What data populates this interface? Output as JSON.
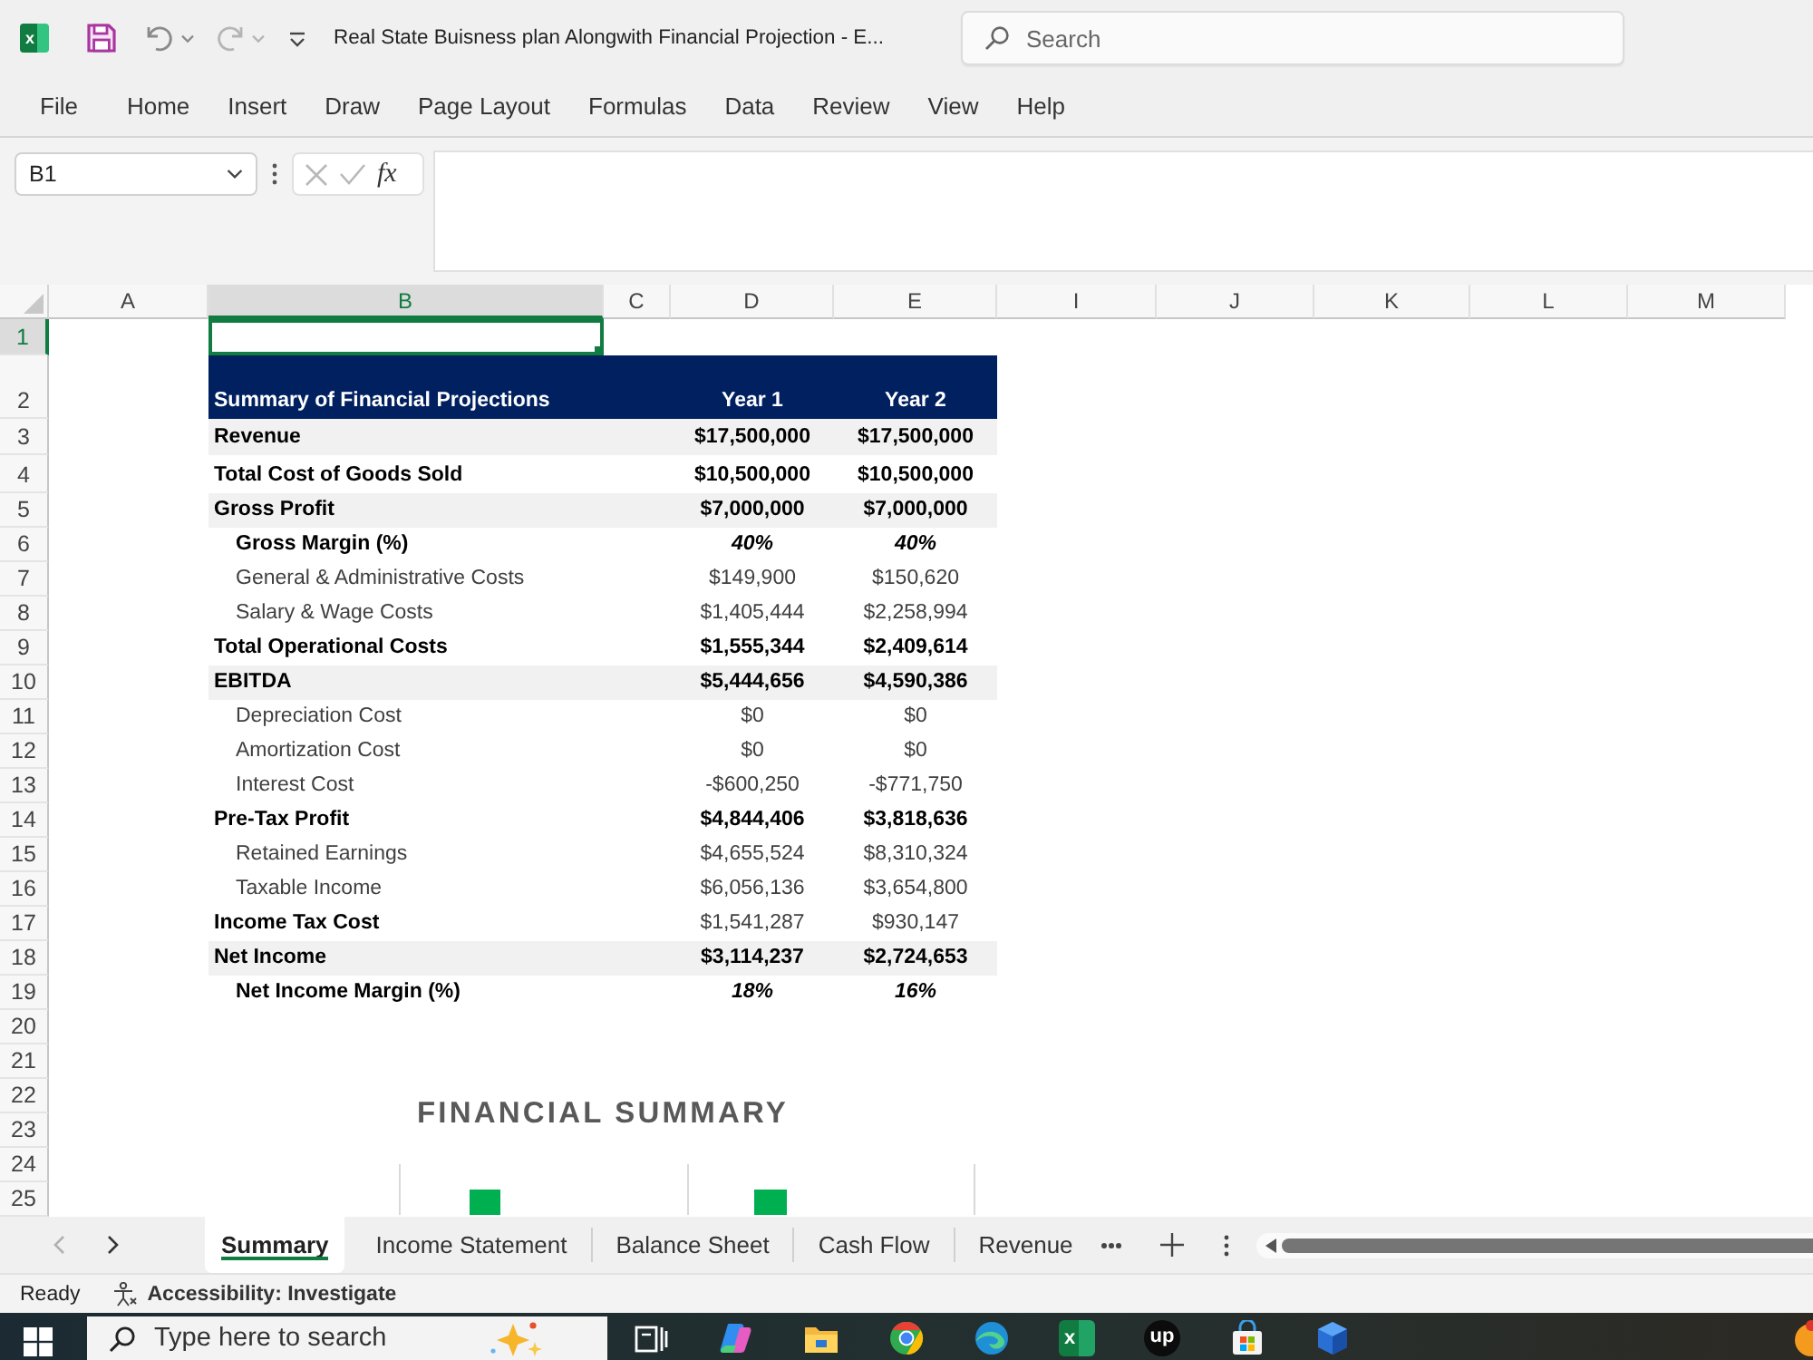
{
  "title_bar": {
    "app_icon_letter": "x",
    "title": "Real State Buisness plan Alongwith Financial Projection - E...",
    "search": {
      "placeholder": "Search"
    }
  },
  "menu": [
    "File",
    "Home",
    "Insert",
    "Draw",
    "Page Layout",
    "Formulas",
    "Data",
    "Review",
    "View",
    "Help"
  ],
  "formula_bar": {
    "name_box": "B1",
    "function_label": "fx"
  },
  "sheet": {
    "columns": [
      {
        "label": "A",
        "selected": false
      },
      {
        "label": "B",
        "selected": true
      },
      {
        "label": "C",
        "selected": false
      },
      {
        "label": "D",
        "selected": false
      },
      {
        "label": "E",
        "selected": false
      },
      {
        "label": "I",
        "selected": false
      },
      {
        "label": "J",
        "selected": false
      },
      {
        "label": "K",
        "selected": false
      },
      {
        "label": "L",
        "selected": false
      },
      {
        "label": "M",
        "selected": false
      }
    ],
    "rows": [
      {
        "label": "1",
        "selected": true
      },
      {
        "label": "2",
        "selected": false
      },
      {
        "label": "3",
        "selected": false
      },
      {
        "label": "4",
        "selected": false
      },
      {
        "label": "5",
        "selected": false
      },
      {
        "label": "6",
        "selected": false
      },
      {
        "label": "7",
        "selected": false
      },
      {
        "label": "8",
        "selected": false
      },
      {
        "label": "9",
        "selected": false
      },
      {
        "label": "10",
        "selected": false
      },
      {
        "label": "11",
        "selected": false
      },
      {
        "label": "12",
        "selected": false
      },
      {
        "label": "13",
        "selected": false
      },
      {
        "label": "14",
        "selected": false
      },
      {
        "label": "15",
        "selected": false
      },
      {
        "label": "16",
        "selected": false
      },
      {
        "label": "17",
        "selected": false
      },
      {
        "label": "18",
        "selected": false
      },
      {
        "label": "19",
        "selected": false
      },
      {
        "label": "20",
        "selected": false
      },
      {
        "label": "21",
        "selected": false
      },
      {
        "label": "22",
        "selected": false
      },
      {
        "label": "23",
        "selected": false
      },
      {
        "label": "24",
        "selected": false
      },
      {
        "label": "25",
        "selected": false
      }
    ]
  },
  "table": {
    "header": {
      "title": "Summary of Financial Projections",
      "columns": [
        "Year 1",
        "Year 2"
      ]
    },
    "rows": [
      {
        "label": "Revenue",
        "values": [
          "$17,500,000",
          "$17,500,000"
        ],
        "indented": false,
        "label_bold": true,
        "values_bold": true,
        "values_italic": false,
        "shaded": true
      },
      {
        "label": "Total Cost of Goods Sold",
        "values": [
          "$10,500,000",
          "$10,500,000"
        ],
        "indented": false,
        "label_bold": true,
        "values_bold": true,
        "values_italic": false,
        "shaded": false
      },
      {
        "label": "Gross Profit",
        "values": [
          "$7,000,000",
          "$7,000,000"
        ],
        "indented": false,
        "label_bold": true,
        "values_bold": true,
        "values_italic": false,
        "shaded": true
      },
      {
        "label": "Gross Margin (%)",
        "values": [
          "40%",
          "40%"
        ],
        "indented": true,
        "label_bold": true,
        "values_bold": true,
        "values_italic": true,
        "shaded": false
      },
      {
        "label": "General & Administrative Costs",
        "values": [
          "$149,900",
          "$150,620"
        ],
        "indented": true,
        "label_bold": false,
        "values_bold": false,
        "values_italic": false,
        "shaded": false
      },
      {
        "label": "Salary & Wage Costs",
        "values": [
          "$1,405,444",
          "$2,258,994"
        ],
        "indented": true,
        "label_bold": false,
        "values_bold": false,
        "values_italic": false,
        "shaded": false
      },
      {
        "label": "Total Operational Costs",
        "values": [
          "$1,555,344",
          "$2,409,614"
        ],
        "indented": false,
        "label_bold": true,
        "values_bold": true,
        "values_italic": false,
        "shaded": false
      },
      {
        "label": "EBITDA",
        "values": [
          "$5,444,656",
          "$4,590,386"
        ],
        "indented": false,
        "label_bold": true,
        "values_bold": true,
        "values_italic": false,
        "shaded": true
      },
      {
        "label": "Depreciation Cost",
        "values": [
          "$0",
          "$0"
        ],
        "indented": true,
        "label_bold": false,
        "values_bold": false,
        "values_italic": false,
        "shaded": false
      },
      {
        "label": "Amortization Cost",
        "values": [
          "$0",
          "$0"
        ],
        "indented": true,
        "label_bold": false,
        "values_bold": false,
        "values_italic": false,
        "shaded": false
      },
      {
        "label": "Interest Cost",
        "values": [
          "-$600,250",
          "-$771,750"
        ],
        "indented": true,
        "label_bold": false,
        "values_bold": false,
        "values_italic": false,
        "shaded": false
      },
      {
        "label": "Pre-Tax Profit",
        "values": [
          "$4,844,406",
          "$3,818,636"
        ],
        "indented": false,
        "label_bold": true,
        "values_bold": true,
        "values_italic": false,
        "shaded": false
      },
      {
        "label": "Retained Earnings",
        "values": [
          "$4,655,524",
          "$8,310,324"
        ],
        "indented": true,
        "label_bold": false,
        "values_bold": false,
        "values_italic": false,
        "shaded": false
      },
      {
        "label": "Taxable Income",
        "values": [
          "$6,056,136",
          "$3,654,800"
        ],
        "indented": true,
        "label_bold": false,
        "values_bold": false,
        "values_italic": false,
        "shaded": false
      },
      {
        "label": "Income Tax Cost",
        "values": [
          "$1,541,287",
          "$930,147"
        ],
        "indented": false,
        "label_bold": true,
        "values_bold": false,
        "values_italic": false,
        "shaded": false
      },
      {
        "label": "Net Income",
        "values": [
          "$3,114,237",
          "$2,724,653"
        ],
        "indented": false,
        "label_bold": true,
        "values_bold": true,
        "values_italic": false,
        "shaded": true
      },
      {
        "label": "Net Income Margin (%)",
        "values": [
          "18%",
          "16%"
        ],
        "indented": true,
        "label_bold": true,
        "values_bold": true,
        "values_italic": true,
        "shaded": false
      }
    ]
  },
  "chart": {
    "title": "FINANCIAL SUMMARY"
  },
  "sheet_nav": {
    "previous_disabled": true,
    "next_disabled": false
  },
  "sheet_tabs": [
    {
      "label": "Summary",
      "selected": true
    },
    {
      "label": "Income Statement",
      "selected": false
    },
    {
      "label": "Balance Sheet",
      "selected": false
    },
    {
      "label": "Cash Flow",
      "selected": false
    },
    {
      "label": "Revenue",
      "selected": false
    }
  ],
  "status_bar": {
    "mode": "Ready",
    "accessibility": "Accessibility: Investigate"
  },
  "taskbar": {
    "search": {
      "placeholder": "Type here to search"
    },
    "apps": [
      {
        "kind": "task-view"
      },
      {
        "kind": "assistant"
      },
      {
        "kind": "folder"
      },
      {
        "kind": "ring-browser"
      },
      {
        "kind": "wave-browser"
      },
      {
        "kind": "spreadsheet",
        "letter": "x"
      },
      {
        "kind": "letter-circle",
        "letter": "up"
      },
      {
        "kind": "store"
      },
      {
        "kind": "mail-cube"
      },
      {
        "kind": "orb"
      }
    ]
  }
}
